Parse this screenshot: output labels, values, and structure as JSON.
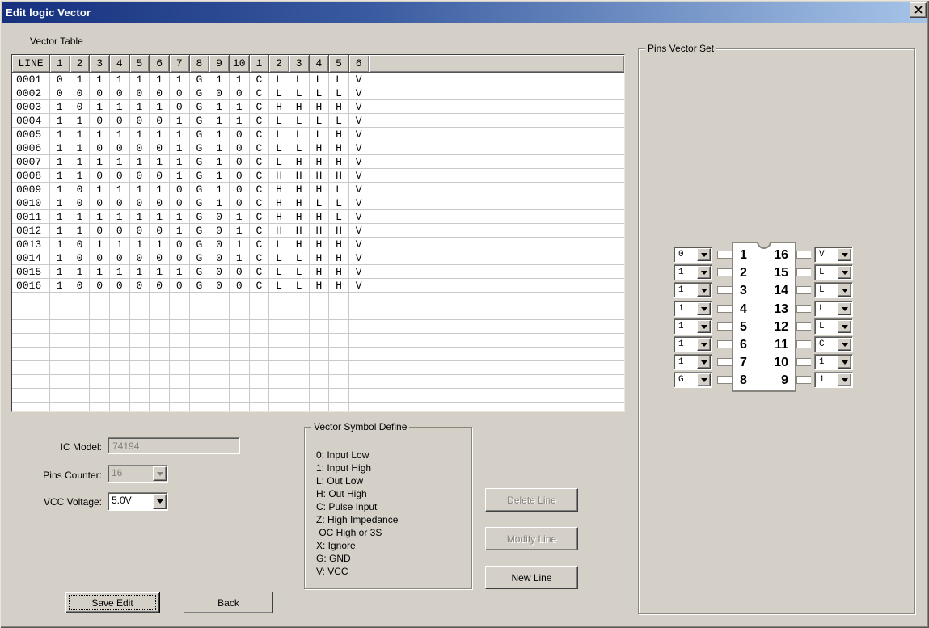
{
  "window": {
    "title": "Edit logic Vector"
  },
  "colors": {
    "titlebar_left": "#16307e",
    "titlebar_right": "#a6c4e8",
    "face": "#d4d0c8",
    "grid_line": "#c9c9c9",
    "disabled_text": "#84827b"
  },
  "vector_table": {
    "label": "Vector Table",
    "columns": [
      "LINE",
      "1",
      "2",
      "3",
      "4",
      "5",
      "6",
      "7",
      "8",
      "9",
      "10",
      "1",
      "2",
      "3",
      "4",
      "5",
      "6"
    ],
    "rows": [
      {
        "line": "0001",
        "cells": [
          "0",
          "1",
          "1",
          "1",
          "1",
          "1",
          "1",
          "G",
          "1",
          "1",
          "C",
          "L",
          "L",
          "L",
          "L",
          "V"
        ]
      },
      {
        "line": "0002",
        "cells": [
          "0",
          "0",
          "0",
          "0",
          "0",
          "0",
          "0",
          "G",
          "0",
          "0",
          "C",
          "L",
          "L",
          "L",
          "L",
          "V"
        ]
      },
      {
        "line": "0003",
        "cells": [
          "1",
          "0",
          "1",
          "1",
          "1",
          "1",
          "0",
          "G",
          "1",
          "1",
          "C",
          "H",
          "H",
          "H",
          "H",
          "V"
        ]
      },
      {
        "line": "0004",
        "cells": [
          "1",
          "1",
          "0",
          "0",
          "0",
          "0",
          "1",
          "G",
          "1",
          "1",
          "C",
          "L",
          "L",
          "L",
          "L",
          "V"
        ]
      },
      {
        "line": "0005",
        "cells": [
          "1",
          "1",
          "1",
          "1",
          "1",
          "1",
          "1",
          "G",
          "1",
          "0",
          "C",
          "L",
          "L",
          "L",
          "H",
          "V"
        ]
      },
      {
        "line": "0006",
        "cells": [
          "1",
          "1",
          "0",
          "0",
          "0",
          "0",
          "1",
          "G",
          "1",
          "0",
          "C",
          "L",
          "L",
          "H",
          "H",
          "V"
        ]
      },
      {
        "line": "0007",
        "cells": [
          "1",
          "1",
          "1",
          "1",
          "1",
          "1",
          "1",
          "G",
          "1",
          "0",
          "C",
          "L",
          "H",
          "H",
          "H",
          "V"
        ]
      },
      {
        "line": "0008",
        "cells": [
          "1",
          "1",
          "0",
          "0",
          "0",
          "0",
          "1",
          "G",
          "1",
          "0",
          "C",
          "H",
          "H",
          "H",
          "H",
          "V"
        ]
      },
      {
        "line": "0009",
        "cells": [
          "1",
          "0",
          "1",
          "1",
          "1",
          "1",
          "0",
          "G",
          "1",
          "0",
          "C",
          "H",
          "H",
          "H",
          "L",
          "V"
        ]
      },
      {
        "line": "0010",
        "cells": [
          "1",
          "0",
          "0",
          "0",
          "0",
          "0",
          "0",
          "G",
          "1",
          "0",
          "C",
          "H",
          "H",
          "L",
          "L",
          "V"
        ]
      },
      {
        "line": "0011",
        "cells": [
          "1",
          "1",
          "1",
          "1",
          "1",
          "1",
          "1",
          "G",
          "0",
          "1",
          "C",
          "H",
          "H",
          "H",
          "L",
          "V"
        ]
      },
      {
        "line": "0012",
        "cells": [
          "1",
          "1",
          "0",
          "0",
          "0",
          "0",
          "1",
          "G",
          "0",
          "1",
          "C",
          "H",
          "H",
          "H",
          "H",
          "V"
        ]
      },
      {
        "line": "0013",
        "cells": [
          "1",
          "0",
          "1",
          "1",
          "1",
          "1",
          "0",
          "G",
          "0",
          "1",
          "C",
          "L",
          "H",
          "H",
          "H",
          "V"
        ]
      },
      {
        "line": "0014",
        "cells": [
          "1",
          "0",
          "0",
          "0",
          "0",
          "0",
          "0",
          "G",
          "0",
          "1",
          "C",
          "L",
          "L",
          "H",
          "H",
          "V"
        ]
      },
      {
        "line": "0015",
        "cells": [
          "1",
          "1",
          "1",
          "1",
          "1",
          "1",
          "1",
          "G",
          "0",
          "0",
          "C",
          "L",
          "L",
          "H",
          "H",
          "V"
        ]
      },
      {
        "line": "0016",
        "cells": [
          "1",
          "0",
          "0",
          "0",
          "0",
          "0",
          "0",
          "G",
          "0",
          "0",
          "C",
          "L",
          "L",
          "H",
          "H",
          "V"
        ]
      }
    ],
    "empty_rows": 9
  },
  "fields": {
    "ic_model": {
      "label": "IC Model:",
      "value": "74194",
      "disabled": true
    },
    "pins_counter": {
      "label": "Pins Counter:",
      "value": "16",
      "disabled": true
    },
    "vcc_voltage": {
      "label": "VCC Voltage:",
      "value": "5.0V",
      "disabled": false
    }
  },
  "symbol_define": {
    "title": "Vector Symbol Define",
    "items": [
      "0: Input Low",
      "1: Input High",
      "L: Out Low",
      "H: Out High",
      "C: Pulse Input",
      "Z: High Impedance",
      " OC High or 3S",
      "X: Ignore",
      "G: GND",
      "V: VCC"
    ]
  },
  "buttons": {
    "delete_line": {
      "label": "Delete Line",
      "disabled": true
    },
    "modify_line": {
      "label": "Modify Line",
      "disabled": true
    },
    "new_line": {
      "label": "New Line",
      "disabled": false
    },
    "save_edit": {
      "label": "Save Edit",
      "default": true
    },
    "back": {
      "label": "Back"
    }
  },
  "pins_vector_set": {
    "title": "Pins Vector Set",
    "left_pins": [
      {
        "pin": "1",
        "value": "0"
      },
      {
        "pin": "2",
        "value": "1"
      },
      {
        "pin": "3",
        "value": "1"
      },
      {
        "pin": "4",
        "value": "1"
      },
      {
        "pin": "5",
        "value": "1"
      },
      {
        "pin": "6",
        "value": "1"
      },
      {
        "pin": "7",
        "value": "1"
      },
      {
        "pin": "8",
        "value": "G"
      }
    ],
    "right_pins": [
      {
        "pin": "16",
        "value": "V"
      },
      {
        "pin": "15",
        "value": "L"
      },
      {
        "pin": "14",
        "value": "L"
      },
      {
        "pin": "13",
        "value": "L"
      },
      {
        "pin": "12",
        "value": "L"
      },
      {
        "pin": "11",
        "value": "C"
      },
      {
        "pin": "10",
        "value": "1"
      },
      {
        "pin": "9",
        "value": "1"
      }
    ]
  }
}
